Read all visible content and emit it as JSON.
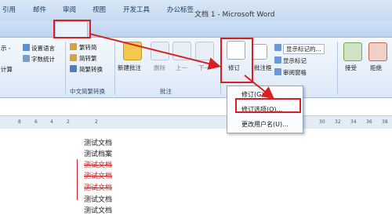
{
  "window": {
    "title": "文档 1 - Microsoft Word"
  },
  "tabs": [
    "引用",
    "邮件",
    "审阅",
    "视图",
    "开发工具",
    "办公标签"
  ],
  "ribbon": {
    "left_items": [
      "示 -",
      "设置语言",
      "字数统计",
      "计算"
    ],
    "chinese_group": {
      "items": [
        "繁转简",
        "简转繁",
        "简繁转换"
      ],
      "label": "中文简繁转换"
    },
    "comment_group": {
      "new_comment": "新建批注",
      "delete": "删除",
      "prev": "上一",
      "next": "下一",
      "label": "批注"
    },
    "tracking_group": {
      "track_changes": "修订",
      "balloon": "批注框",
      "show_markup": "显示标记的...",
      "show_markup_btn": "显示标记",
      "review_pane": "审阅窗格"
    },
    "right_group": {
      "accept": "接受",
      "reject": "拒绝"
    }
  },
  "dropdown": {
    "items": [
      "修订(G)",
      "修订选项(O)...",
      "更改用户名(U)..."
    ]
  },
  "ruler": {
    "ticks": [
      "8",
      "6",
      "4",
      "2",
      "2",
      "30",
      "32",
      "34",
      "36",
      "38"
    ]
  },
  "document": {
    "lines": [
      "测试文档",
      "测试档案",
      "测试文档",
      "测试文档",
      "测试文档",
      "测试文档",
      "测试文档"
    ]
  }
}
